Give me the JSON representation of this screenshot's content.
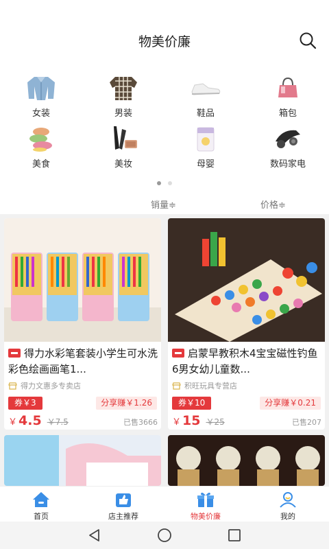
{
  "header": {
    "title": "物美价廉"
  },
  "categories": [
    {
      "label": "女装",
      "icon": "denim-jacket-icon"
    },
    {
      "label": "男装",
      "icon": "plaid-shirt-icon"
    },
    {
      "label": "鞋品",
      "icon": "sneaker-icon"
    },
    {
      "label": "箱包",
      "icon": "handbag-icon"
    },
    {
      "label": "美食",
      "icon": "macaron-icon"
    },
    {
      "label": "美妆",
      "icon": "makeup-brush-icon"
    },
    {
      "label": "母婴",
      "icon": "diaper-pack-icon"
    },
    {
      "label": "数码家电",
      "icon": "earphones-icon"
    }
  ],
  "sort": {
    "sales": "销量≑",
    "price": "价格≑"
  },
  "products": [
    {
      "title": "得力水彩笔套装小学生可水洗彩色绘画画笔1...",
      "shop": "得力文惠多专卖店",
      "coupon": "券￥3",
      "share": "分享赚￥1.26",
      "currency": "￥",
      "price": "4.5",
      "original": "￥7.5",
      "sold": "已售3666"
    },
    {
      "title": "启蒙早教积木4宝宝磁性钓鱼6男女幼儿童数...",
      "shop": "积旺玩具专营店",
      "coupon": "券￥10",
      "share": "分享赚￥0.21",
      "currency": "￥",
      "price": "15",
      "original": "￥25",
      "sold": "已售207"
    }
  ],
  "tabs": [
    {
      "label": "首页",
      "icon": "home-icon"
    },
    {
      "label": "店主推荐",
      "icon": "thumbs-up-icon"
    },
    {
      "label": "物美价廉",
      "icon": "gift-box-icon"
    },
    {
      "label": "我的",
      "icon": "user-icon"
    }
  ],
  "colors": {
    "accent": "#e4393c",
    "tab_blue": "#3a8ee6"
  }
}
